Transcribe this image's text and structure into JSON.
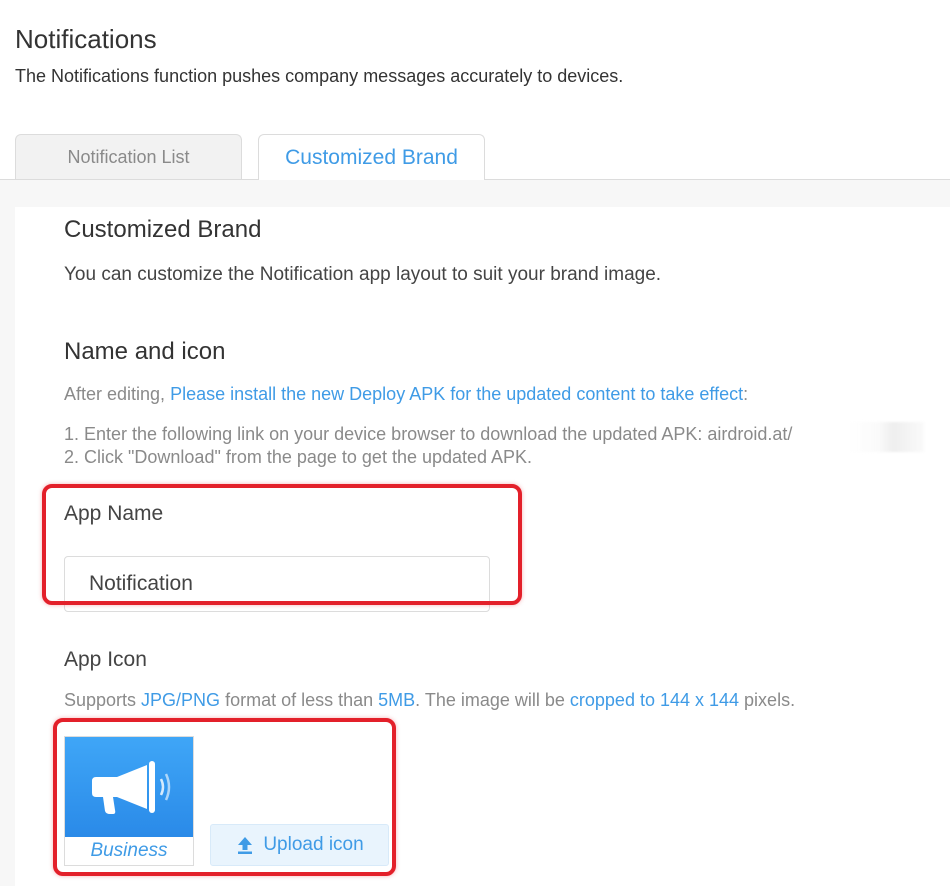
{
  "header": {
    "title": "Notifications",
    "description": "The Notifications function pushes company messages accurately to devices."
  },
  "tabs": [
    {
      "label": "Notification List",
      "active": false
    },
    {
      "label": "Customized Brand",
      "active": true
    }
  ],
  "brand": {
    "title": "Customized Brand",
    "description": "You can customize the Notification app layout to suit your brand image."
  },
  "name_and_icon": {
    "title": "Name and icon",
    "after_editing_prefix": "After editing, ",
    "after_editing_link": "Please install the new Deploy APK for the updated content to take effect",
    "after_editing_suffix": ":",
    "step1": "1. Enter the following link on your device browser to download the updated APK: airdroid.at/",
    "step2": "2. Click \"Download\" from the page to get the updated APK."
  },
  "app_name": {
    "label": "App Name",
    "value": "Notification"
  },
  "app_icon": {
    "label": "App Icon",
    "supports_prefix": "Supports ",
    "supports_format": "JPG/PNG",
    "supports_mid": " format of less than ",
    "supports_size": "5MB",
    "supports_mid2": ". The image will be ",
    "supports_crop": "cropped to 144 x 144",
    "supports_suffix": " pixels.",
    "icon_caption": "Business",
    "upload_label": "Upload icon"
  },
  "colors": {
    "accent": "#3f9be6",
    "highlight": "#e3202a",
    "icon_blue": "#2a8ae8"
  }
}
